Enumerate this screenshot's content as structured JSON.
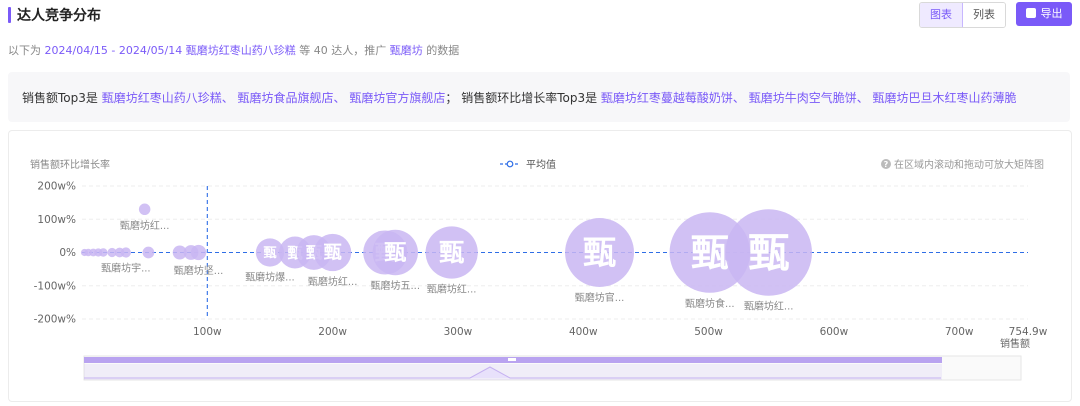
{
  "header": {
    "title": "达人竞争分布",
    "view_chart": "图表",
    "view_list": "列表",
    "export_label": "导出"
  },
  "subtitle": {
    "prefix": "以下为",
    "date_range": "2024/04/15 - 2024/05/14",
    "product": "甄磨坊红枣山药八珍糕",
    "mid": "等 40 达人，推广",
    "brand": "甄磨坊",
    "suffix": "的数据"
  },
  "summary": {
    "sales_label": "销售额Top3是",
    "sales_top3": "甄磨坊红枣山药八珍糕、 甄磨坊食品旗舰店、 甄磨坊官方旗舰店",
    "sep": "；",
    "growth_label": "销售额环比增长率Top3是",
    "growth_top3": "甄磨坊红枣蔓越莓酸奶饼、 甄磨坊牛肉空气脆饼、 甄磨坊巴旦木红枣山药薄脆"
  },
  "chart_hint": "在区域内滚动和拖动可放大矩阵图",
  "colors": {
    "accent": "#7a5af8",
    "bubble": "#c9b6f2",
    "avg_line": "#2f6ee6"
  },
  "chart_data": {
    "type": "scatter",
    "ylabel": "销售额环比增长率",
    "xlabel": "销售额",
    "legend": "平均值",
    "legend_position": "top-center",
    "xlim": [
      0,
      754.9
    ],
    "ylim": [
      -200,
      200
    ],
    "x_ticks": [
      "100w",
      "200w",
      "300w",
      "400w",
      "500w",
      "600w",
      "700w",
      "754.9w"
    ],
    "y_ticks": [
      "200w%",
      "100w%",
      "0%",
      "-100w%",
      "-200w%"
    ],
    "avg_x": 100,
    "avg_y": 0,
    "bubble_glyph": "甄",
    "points": [
      {
        "x": 50,
        "y": 130,
        "label": "甄磨坊红..."
      },
      {
        "x": 2,
        "y": 0,
        "label": ""
      },
      {
        "x": 5,
        "y": 0,
        "label": ""
      },
      {
        "x": 9,
        "y": 0,
        "label": ""
      },
      {
        "x": 13,
        "y": 0,
        "label": ""
      },
      {
        "x": 17,
        "y": 0,
        "label": ""
      },
      {
        "x": 24,
        "y": 0,
        "label": ""
      },
      {
        "x": 30,
        "y": 0,
        "label": ""
      },
      {
        "x": 35,
        "y": 0,
        "label": "甄磨坊宇..."
      },
      {
        "x": 53,
        "y": 0,
        "label": ""
      },
      {
        "x": 78,
        "y": 0,
        "label": ""
      },
      {
        "x": 87,
        "y": 0,
        "label": ""
      },
      {
        "x": 93,
        "y": 0,
        "label": "甄磨坊坚..."
      },
      {
        "x": 150,
        "y": 0,
        "label": "甄磨坊爆..."
      },
      {
        "x": 170,
        "y": 0,
        "label": ""
      },
      {
        "x": 185,
        "y": 0,
        "label": ""
      },
      {
        "x": 200,
        "y": 0,
        "label": "甄磨坊红..."
      },
      {
        "x": 242,
        "y": 0,
        "label": ""
      },
      {
        "x": 250,
        "y": 0,
        "label": "甄磨坊五..."
      },
      {
        "x": 295,
        "y": 0,
        "label": "甄磨坊红..."
      },
      {
        "x": 413,
        "y": 0,
        "label": "甄磨坊官..."
      },
      {
        "x": 501,
        "y": 0,
        "label": "甄磨坊食..."
      },
      {
        "x": 548,
        "y": 0,
        "label": "甄磨坊红..."
      }
    ]
  }
}
